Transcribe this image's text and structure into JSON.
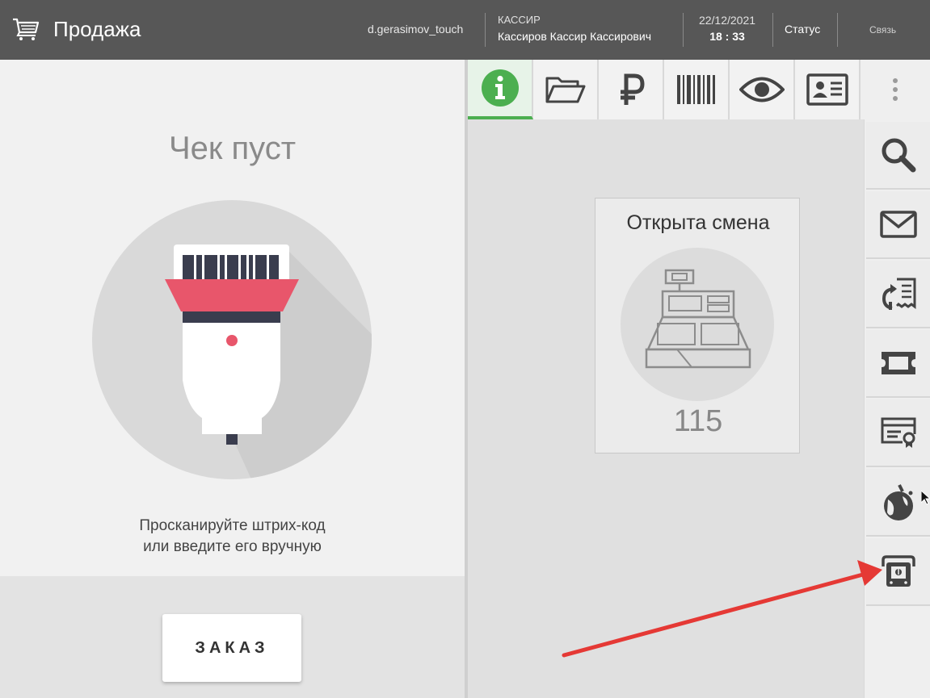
{
  "header": {
    "title": "Продажа",
    "user": "d.gerasimov_touch",
    "role": "КАССИР",
    "cashier_name": "Кассиров Кассир Кассирович",
    "date": "22/12/2021",
    "time": "18 : 33",
    "status_label": "Статус",
    "connection_label": "Связь"
  },
  "receipt": {
    "empty_title": "Чек пуст",
    "hint_line1": "Просканируйте штрих-код",
    "hint_line2": "или введите его вручную",
    "order_button": "ЗАКАЗ"
  },
  "tabs": [
    {
      "icon": "info-icon",
      "active": true
    },
    {
      "icon": "folder-open-icon",
      "active": false
    },
    {
      "icon": "ruble-icon",
      "active": false
    },
    {
      "icon": "barcode-icon",
      "active": false
    },
    {
      "icon": "eye-icon",
      "active": false
    },
    {
      "icon": "id-card-icon",
      "active": false
    },
    {
      "icon": "more-vertical-icon",
      "active": false
    }
  ],
  "shift": {
    "label": "Открыта смена",
    "number": "115"
  },
  "sidebar": {
    "items": [
      {
        "icon": "search-icon"
      },
      {
        "icon": "envelope-icon"
      },
      {
        "icon": "receipt-return-icon"
      },
      {
        "icon": "ticket-icon"
      },
      {
        "icon": "certificate-icon"
      },
      {
        "icon": "loyalty-icon"
      },
      {
        "icon": "cash-drawer-icon"
      }
    ]
  },
  "colors": {
    "header_bg": "#575757",
    "accent_green": "#4caf50",
    "scanner_red": "#e8566b",
    "annotation_arrow": "#e53935"
  }
}
